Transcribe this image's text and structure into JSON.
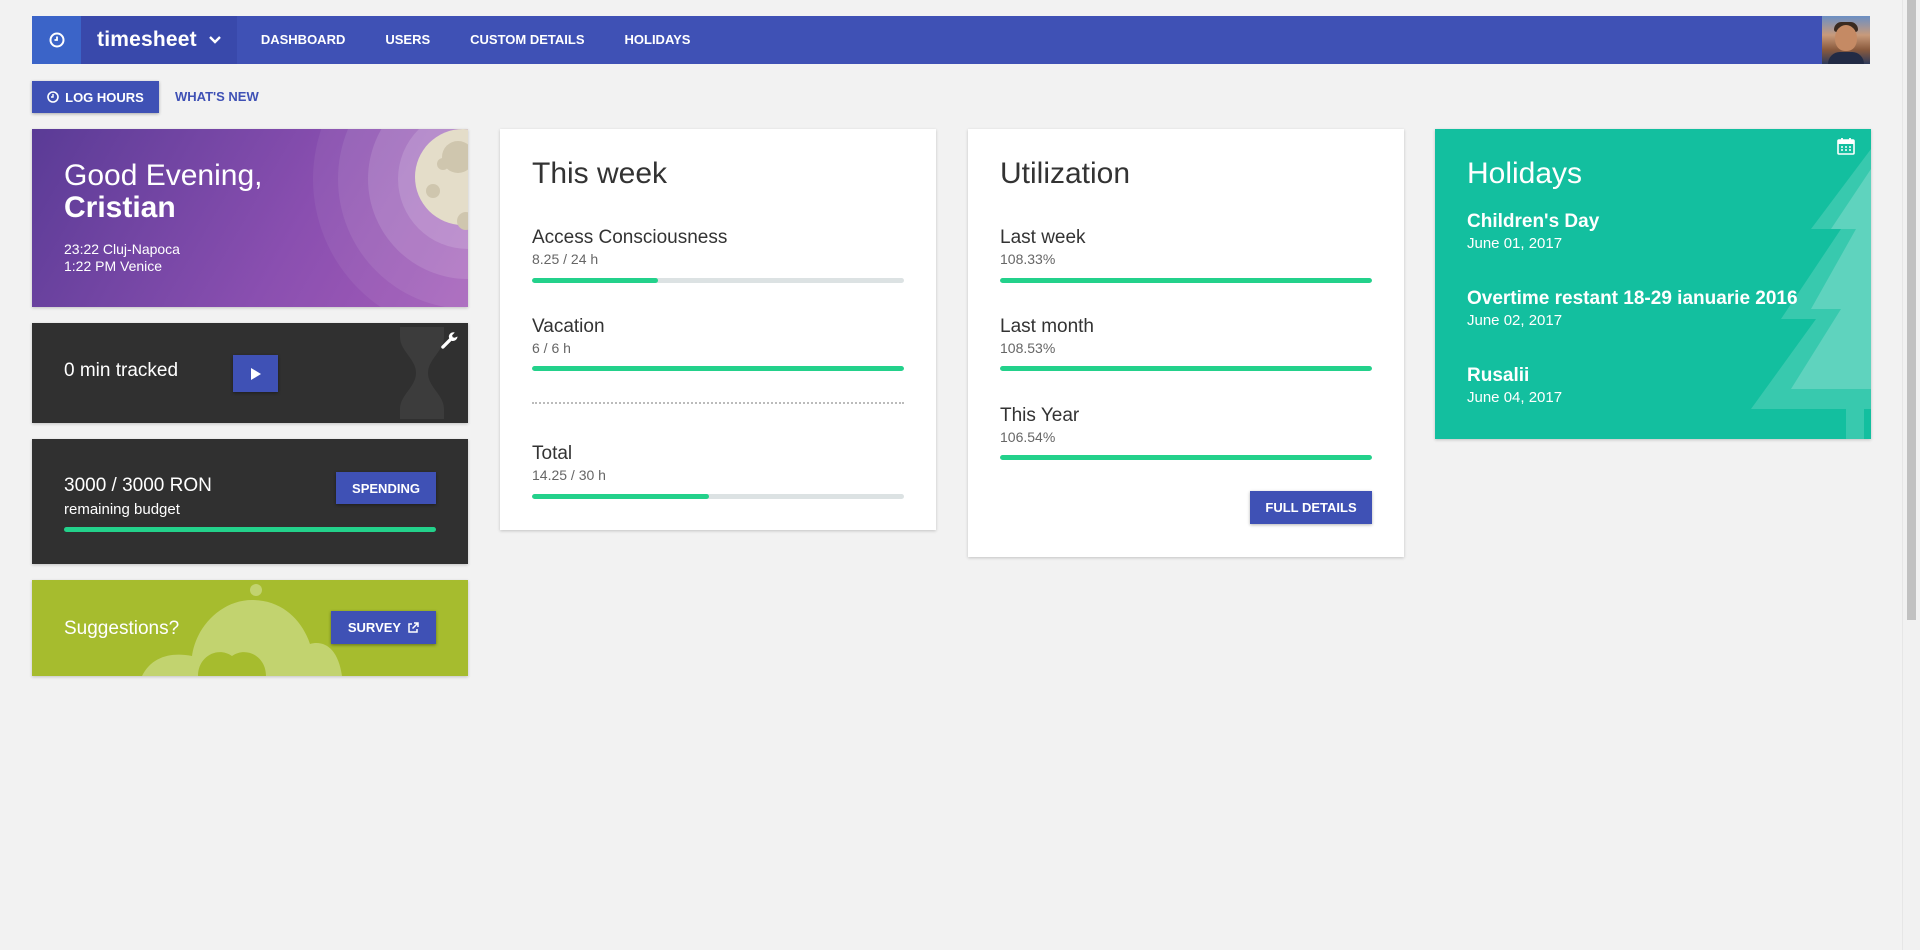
{
  "navbar": {
    "brand": "timesheet",
    "links": [
      "DASHBOARD",
      "USERS",
      "CUSTOM DETAILS",
      "HOLIDAYS"
    ]
  },
  "toolbar": {
    "log_hours": "LOG HOURS",
    "whats_new": "WHAT'S NEW"
  },
  "greeting": {
    "line1": "Good Evening,",
    "name": "Cristian",
    "time1": "23:22 Cluj-Napoca",
    "time2": "1:22 PM Venice"
  },
  "tracker": {
    "text": "0 min tracked"
  },
  "budget": {
    "amount": "3000 / 3000 RON",
    "label": "remaining budget",
    "button": "SPENDING",
    "progress": 1.0
  },
  "suggestions": {
    "text": "Suggestions?",
    "button": "SURVEY"
  },
  "this_week": {
    "title": "This week",
    "rows": [
      {
        "label": "Access Consciousness",
        "value": "8.25 / 24 h",
        "progress": 0.34
      },
      {
        "label": "Vacation",
        "value": "6 / 6 h",
        "progress": 1.0
      }
    ],
    "total": {
      "label": "Total",
      "value": "14.25 / 30 h",
      "progress": 0.475
    }
  },
  "utilization": {
    "title": "Utilization",
    "rows": [
      {
        "label": "Last week",
        "value": "108.33%",
        "progress": 1.0
      },
      {
        "label": "Last month",
        "value": "108.53%",
        "progress": 1.0
      },
      {
        "label": "This Year",
        "value": "106.54%",
        "progress": 1.0
      }
    ],
    "button": "FULL DETAILS"
  },
  "holidays": {
    "title": "Holidays",
    "items": [
      {
        "name": "Children's Day",
        "date": "June 01, 2017"
      },
      {
        "name": "Overtime restant 18-29 ianuarie 2016",
        "date": "June 02, 2017"
      },
      {
        "name": "Rusalii",
        "date": "June 04, 2017"
      }
    ]
  },
  "colors": {
    "primary": "#3f51b5",
    "progress": "#23d18b",
    "holidays_bg": "#13bf9f",
    "suggest_bg": "#a6bc2e",
    "dark_card": "#303030"
  }
}
